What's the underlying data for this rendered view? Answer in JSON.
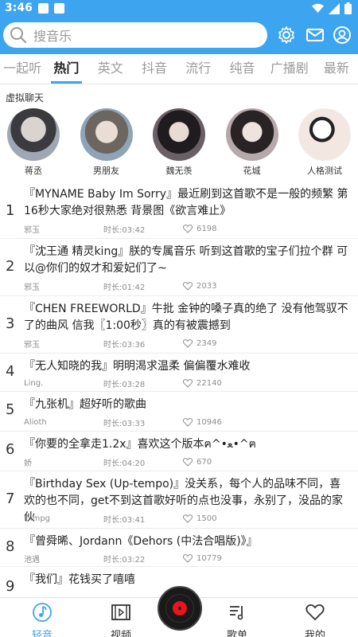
{
  "status": {
    "time": "3:46"
  },
  "search": {
    "placeholder": "搜音乐"
  },
  "tabs": [
    "一起听",
    "热门",
    "英文",
    "抖音",
    "流行",
    "纯音",
    "广播剧",
    "最新"
  ],
  "active_tab": "热门",
  "virtual_chat": {
    "title": "虚拟聊天",
    "characters": [
      {
        "name": "蒋丞",
        "color": "#9fa7b5"
      },
      {
        "name": "男朋友",
        "color": "#8fa4b8"
      },
      {
        "name": "魏无羡",
        "color": "#6a5f64"
      },
      {
        "name": "花城",
        "color": "#b7a9ab"
      },
      {
        "name": "人格测试",
        "color": "#f3e7e2"
      }
    ]
  },
  "songs": [
    {
      "rank": "1",
      "title": "『MYNAME  Baby Im Sorry』最近刷到这首歌不是一般的频繁 第16秒大家绝对很熟悉 背景图《欲言难止》",
      "author": "邪玉",
      "duration": "时长:03:42",
      "likes": "6198"
    },
    {
      "rank": "2",
      "title": "『沈王通  精灵king』朕的专属音乐 听到这首歌的宝子们拉个群 可以@你们的奴才和爱妃们了~",
      "author": "邪玉",
      "duration": "时长:01:42",
      "likes": "2033"
    },
    {
      "rank": "3",
      "title": "『CHEN  FREEWORLD』牛批 金钟的嗓子真的绝了 没有他驾驭不了的曲风 信我〖1:00秒〗真的有被震撼到",
      "author": "邪玉",
      "duration": "时长:03:36",
      "likes": "2349"
    },
    {
      "rank": "4",
      "title": "『无人知晓的我』明明渴求温柔 偏偏覆水难收",
      "author": "Ling.",
      "duration": "时长:03:28",
      "likes": "22140"
    },
    {
      "rank": "5",
      "title": "『九张机』超好听的歌曲",
      "author": "Alioth",
      "duration": "时长:03:33",
      "likes": "10946"
    },
    {
      "rank": "6",
      "title": "『你要的全拿走1.2x』喜欢这个版本ฅ^•ﻌ•^ฅ",
      "author": "娇",
      "duration": "时长:04:20",
      "likes": "670"
    },
    {
      "rank": "7",
      "title": "『Birthday Sex (Up-tempo)』没关系，每个人的品味不同，喜欢的也不同，get不到这首歌好听的点也没事，永别了，没品的家伙",
      "author": "Filmpg",
      "duration": "时长:03:41",
      "likes": "1500"
    },
    {
      "rank": "8",
      "title": "『曾舜晞、Jordann《Dehors (中法合唱版)》』",
      "author": "池遇",
      "duration": "时长:03:22",
      "likes": "10779"
    },
    {
      "rank": "9",
      "title": "『我们』花钱买了嘻嘻",
      "author": "",
      "duration": "",
      "likes": ""
    }
  ],
  "bottom_nav": {
    "items": [
      {
        "label": "轻音",
        "icon": "music-note-icon"
      },
      {
        "label": "视频",
        "icon": "film-icon"
      },
      {
        "label": "歌单",
        "icon": "playlist-icon"
      },
      {
        "label": "我的",
        "icon": "heart-icon"
      }
    ]
  },
  "colors": {
    "accent": "#3da5ef",
    "disc_red": "#e8141e"
  }
}
